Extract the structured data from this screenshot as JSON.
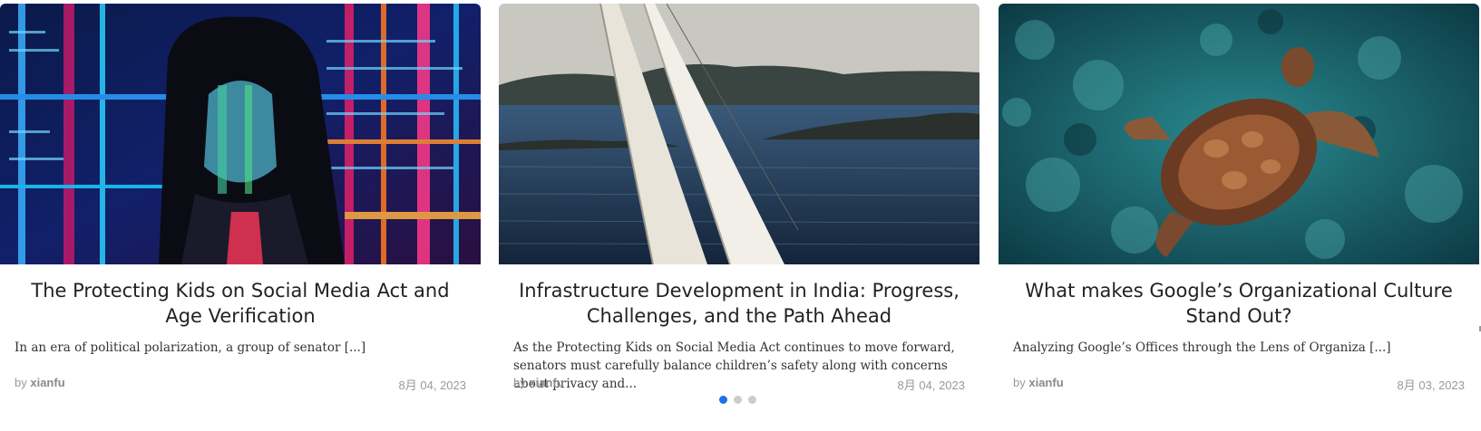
{
  "posts": [
    {
      "image": "hacker-woman-projected-code-photo",
      "title": "The Protecting Kids on Social Media Act and Age Verification",
      "excerpt": "In an era of political polarization, a group of senator [...]",
      "by_label": "by",
      "author": "xianfu",
      "date": "8月 04, 2023"
    },
    {
      "image": "sailboat-sails-coastline-photo",
      "title": "Infrastructure Development in India: Progress, Challenges, and the Path Ahead",
      "excerpt": "As the Protecting Kids on Social Media Act continues to move forward, senators must carefully balance children’s safety along with concerns about privacy and...",
      "by_label": "by",
      "author": "xianfu",
      "date": "8月 04, 2023"
    },
    {
      "image": "sea-turtle-reef-photo",
      "title": "What makes Google’s Organizational Culture Stand Out?",
      "excerpt": "Analyzing Google’s Offices through the Lens of Organiza [...]",
      "by_label": "by",
      "author": "xianfu",
      "date": "8月 03, 2023"
    }
  ],
  "pagination": {
    "total": 3,
    "active": 1
  },
  "colors": {
    "accent": "#1a73e8",
    "dot_inactive": "#cccccc",
    "meta": "#999999"
  }
}
